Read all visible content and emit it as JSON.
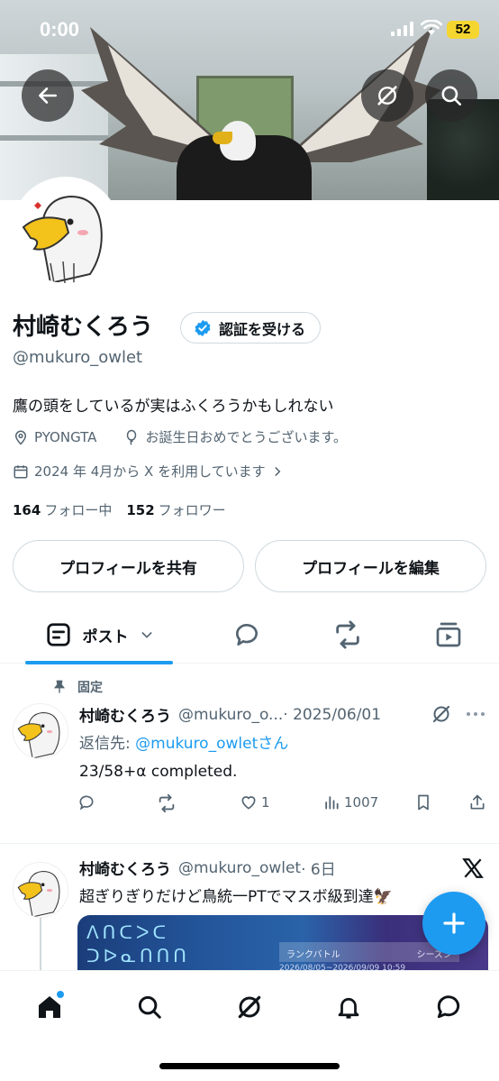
{
  "status_bar": {
    "time": "0:00",
    "battery": "52"
  },
  "profile": {
    "display_name": "村崎むくろう",
    "verify_button": "認証を受ける",
    "handle": "@mukuro_owlet",
    "bio": "鷹の頭をしているが実はふくろうかもしれない",
    "location": "PYONGTA",
    "birthday": "お誕生日おめでとうございます。",
    "joined": "2024 年 4月から X を利用しています",
    "following_count": "164",
    "following_label": "フォロー中",
    "followers_count": "152",
    "followers_label": "フォロワー",
    "share_button": "プロフィールを共有",
    "edit_button": "プロフィールを編集"
  },
  "tabs": {
    "posts_label": "ポスト"
  },
  "posts": [
    {
      "pinned_label": "固定",
      "name": "村崎むくろう",
      "handle": "@mukuro_o...",
      "date": "· 2025/06/01",
      "reply_prefix": "返信先: ",
      "reply_target": "@mukuro_owletさん",
      "text": "23/58+α completed.",
      "likes": "1",
      "views": "1007"
    },
    {
      "name": "村崎むくろう",
      "handle": "@mukuro_owlet",
      "date": "· 6日",
      "text": "超ぎりぎりだけど鳥統一PTでマスボ級到達🦅",
      "media_title": "ランクバトル",
      "media_season": "シーズン",
      "media_dates": "2026/08/05~2026/09/09  10:59",
      "media_glyphs": "ᐱᑎᑕᐳᑕ\nᑐᐅᓇᑎᑎᑎ"
    }
  ],
  "colors": {
    "accent": "#1d9bf0",
    "text": "#0f1419",
    "muted": "#536471"
  },
  "icons": [
    "back-arrow-icon",
    "grok-icon",
    "search-icon",
    "verified-badge-icon",
    "location-icon",
    "balloon-icon",
    "calendar-icon",
    "chevron-right-icon",
    "posts-tab-icon",
    "chevron-down-icon",
    "reply-icon",
    "repost-icon",
    "media-icon",
    "pin-icon",
    "more-icon",
    "like-icon",
    "views-icon",
    "bookmark-icon",
    "share-icon",
    "x-logo-icon",
    "plus-icon",
    "home-icon",
    "notifications-icon",
    "messages-icon"
  ]
}
